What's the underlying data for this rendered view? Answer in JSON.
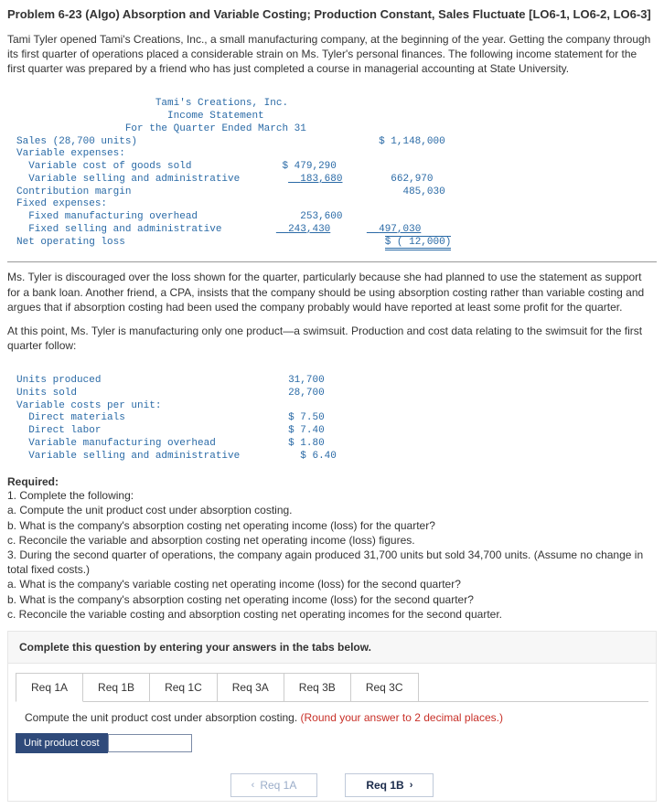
{
  "title": "Problem 6-23 (Algo) Absorption and Variable Costing; Production Constant, Sales Fluctuate [LO6-1, LO6-2, LO6-3]",
  "para1": "Tami Tyler opened Tami's Creations, Inc., a small manufacturing company, at the beginning of the year. Getting the company through its first quarter of operations placed a considerable strain on Ms. Tyler's personal finances. The following income statement for the first quarter was prepared by a friend who has just completed a course in managerial accounting at State University.",
  "stmt": {
    "h1": "Tami's Creations, Inc.",
    "h2": "Income Statement",
    "h3": "For the Quarter Ended March 31",
    "r1l": "Sales (28,700 units)",
    "r1v": "$ 1,148,000",
    "r2l": "Variable expenses:",
    "r3l": "  Variable cost of goods sold",
    "r3v": "$ 479,290",
    "r4l": "  Variable selling and administrative",
    "r4v": "183,680",
    "r4t": "662,970",
    "r5l": "Contribution margin",
    "r5v": "485,030",
    "r6l": "Fixed expenses:",
    "r7l": "  Fixed manufacturing overhead",
    "r7v": "253,600",
    "r8l": "  Fixed selling and administrative",
    "r8v": "243,430",
    "r8t": "497,030",
    "r9l": "Net operating loss",
    "r9v": "$ ( 12,000)"
  },
  "para2": "Ms. Tyler is discouraged over the loss shown for the quarter, particularly because she had planned to use the statement as support for a bank loan. Another friend, a CPA, insists that the company should be using absorption costing rather than variable costing and argues that if absorption costing had been used the company probably would have reported at least some profit for the quarter.",
  "para3": "At this point, Ms. Tyler is manufacturing only one product—a swimsuit. Production and cost data relating to the swimsuit for the first quarter follow:",
  "data": {
    "r1l": "Units produced",
    "r1v": "31,700",
    "r2l": "Units sold",
    "r2v": "28,700",
    "r3l": "Variable costs per unit:",
    "r4l": "  Direct materials",
    "r4v": "$ 7.50",
    "r5l": "  Direct labor",
    "r5v": "$ 7.40",
    "r6l": "  Variable manufacturing overhead",
    "r6v": "$ 1.80",
    "r7l": "  Variable selling and administrative",
    "r7v": "$ 6.40"
  },
  "req": {
    "label": "Required:",
    "l1": "1. Complete the following:",
    "la": "a. Compute the unit product cost under absorption costing.",
    "lb": "b. What is the company's absorption costing net operating income (loss) for the quarter?",
    "lc": "c. Reconcile the variable and absorption costing net operating income (loss) figures.",
    "l3": "3. During the second quarter of operations, the company again produced 31,700 units but sold 34,700 units. (Assume no change in total fixed costs.)",
    "l3a": "a. What is the company's variable costing net operating income (loss) for the second quarter?",
    "l3b": "b. What is the company's absorption costing net operating income (loss) for the second quarter?",
    "l3c": "c. Reconcile the variable costing and absorption costing net operating incomes for the second quarter."
  },
  "ans": {
    "instr": "Complete this question by entering your answers in the tabs below.",
    "tabs": {
      "t1": "Req 1A",
      "t2": "Req 1B",
      "t3": "Req 1C",
      "t4": "Req 3A",
      "t5": "Req 3B",
      "t6": "Req 3C"
    },
    "subinstr_main": "Compute the unit product cost under absorption costing. ",
    "subinstr_hint": "(Round your answer to 2 decimal places.)",
    "input_label": "Unit product cost",
    "prev": "Req 1A",
    "next": "Req 1B"
  }
}
